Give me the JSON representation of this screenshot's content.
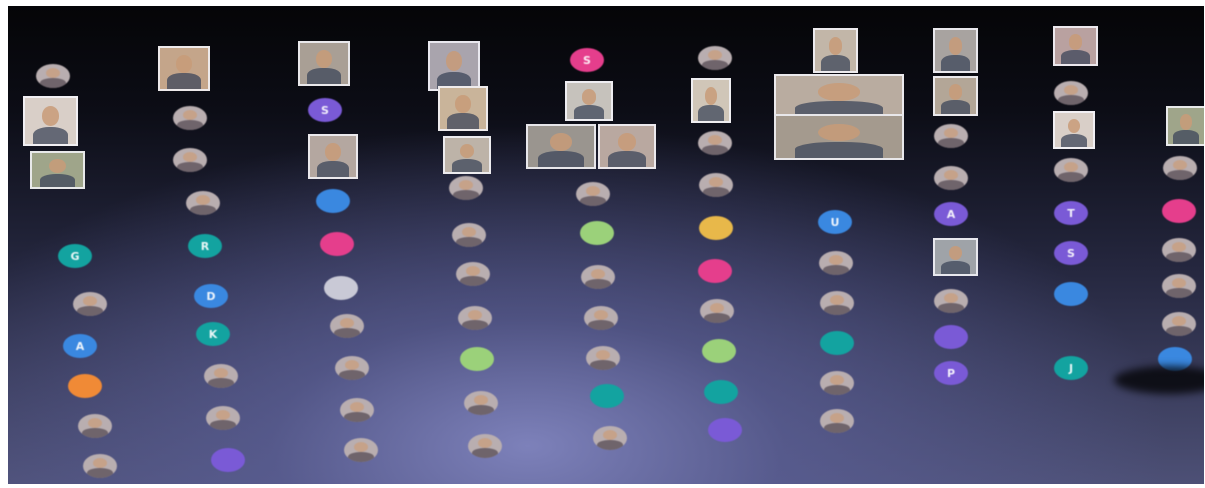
{
  "window": {
    "title": ""
  },
  "colors": {
    "pink": "#e53e8c",
    "purple": "#7a5ad6",
    "blue": "#3a88e0",
    "teal": "#13a3a0",
    "orange": "#f08a36",
    "green": "#9bd17a",
    "yellow": "#e8b84a",
    "gray": "#c9c9d6",
    "photo": "#b9aeb0"
  },
  "tiles": [
    {
      "name": "video-tile-1",
      "bg": "#d9cfc8"
    },
    {
      "name": "video-tile-2",
      "bg": "#9fa58a"
    },
    {
      "name": "video-tile-3",
      "bg": "#c4a58a"
    },
    {
      "name": "video-tile-4",
      "bg": "#a99f95"
    },
    {
      "name": "video-tile-5",
      "bg": "#b4a7a0"
    },
    {
      "name": "video-tile-6",
      "bg": "#a9a4ad"
    },
    {
      "name": "video-tile-7",
      "bg": "#c9b49a"
    },
    {
      "name": "video-tile-8",
      "bg": "#bdb3a8"
    },
    {
      "name": "video-tile-9",
      "bg": "#c6c2bc"
    },
    {
      "name": "video-tile-10",
      "bg": "#9a958f"
    },
    {
      "name": "video-tile-11",
      "bg": "#b9a8a0"
    },
    {
      "name": "video-tile-12",
      "bg": "#d0c6b8"
    },
    {
      "name": "video-tile-13",
      "bg": "#c2b6a8"
    },
    {
      "name": "video-tile-14",
      "bg": "#b9aca0"
    },
    {
      "name": "video-tile-15",
      "bg": "#a49a8e"
    },
    {
      "name": "video-tile-16",
      "bg": "#a8a3a0"
    },
    {
      "name": "video-tile-17",
      "bg": "#b3a697"
    },
    {
      "name": "video-tile-18",
      "bg": "#9fa3a8"
    },
    {
      "name": "video-tile-19",
      "bg": "#b9a1a0"
    }
  ],
  "avatars": [
    {
      "label": "",
      "color": "photo"
    },
    {
      "label": "G",
      "color": "teal"
    },
    {
      "label": "",
      "color": "photo"
    },
    {
      "label": "A",
      "color": "blue"
    },
    {
      "label": "",
      "color": "orange"
    },
    {
      "label": "",
      "color": "photo"
    },
    {
      "label": "",
      "color": "photo"
    },
    {
      "label": "",
      "color": "photo"
    },
    {
      "label": "",
      "color": "photo"
    },
    {
      "label": "",
      "color": "photo"
    },
    {
      "label": "R",
      "color": "teal"
    },
    {
      "label": "D",
      "color": "blue"
    },
    {
      "label": "K",
      "color": "teal"
    },
    {
      "label": "",
      "color": "photo"
    },
    {
      "label": "",
      "color": "photo"
    },
    {
      "label": "",
      "color": "purple"
    },
    {
      "label": "S",
      "color": "purple"
    },
    {
      "label": "",
      "color": "blue"
    },
    {
      "label": "",
      "color": "pink"
    },
    {
      "label": "",
      "color": "gray"
    },
    {
      "label": "",
      "color": "photo"
    },
    {
      "label": "",
      "color": "photo"
    },
    {
      "label": "",
      "color": "photo"
    },
    {
      "label": "",
      "color": "photo"
    },
    {
      "label": "",
      "color": "photo"
    },
    {
      "label": "",
      "color": "photo"
    },
    {
      "label": "",
      "color": "photo"
    },
    {
      "label": "",
      "color": "photo"
    },
    {
      "label": "",
      "color": "green"
    },
    {
      "label": "",
      "color": "photo"
    },
    {
      "label": "",
      "color": "photo"
    },
    {
      "label": "S",
      "color": "pink"
    },
    {
      "label": "",
      "color": "photo"
    },
    {
      "label": "",
      "color": "green"
    },
    {
      "label": "",
      "color": "photo"
    },
    {
      "label": "",
      "color": "photo"
    },
    {
      "label": "",
      "color": "photo"
    },
    {
      "label": "",
      "color": "teal"
    },
    {
      "label": "",
      "color": "photo"
    },
    {
      "label": "",
      "color": "photo"
    },
    {
      "label": "",
      "color": "photo"
    },
    {
      "label": "",
      "color": "photo"
    },
    {
      "label": "",
      "color": "yellow"
    },
    {
      "label": "",
      "color": "pink"
    },
    {
      "label": "",
      "color": "photo"
    },
    {
      "label": "",
      "color": "green"
    },
    {
      "label": "",
      "color": "teal"
    },
    {
      "label": "",
      "color": "purple"
    },
    {
      "label": "U",
      "color": "blue"
    },
    {
      "label": "",
      "color": "photo"
    },
    {
      "label": "",
      "color": "photo"
    },
    {
      "label": "",
      "color": "teal"
    },
    {
      "label": "",
      "color": "photo"
    },
    {
      "label": "",
      "color": "photo"
    },
    {
      "label": "",
      "color": "photo"
    },
    {
      "label": "",
      "color": "photo"
    },
    {
      "label": "A",
      "color": "purple"
    },
    {
      "label": "",
      "color": "photo"
    },
    {
      "label": "",
      "color": "purple"
    },
    {
      "label": "P",
      "color": "purple"
    },
    {
      "label": "",
      "color": "photo"
    },
    {
      "label": "",
      "color": "photo"
    },
    {
      "label": "T",
      "color": "purple"
    },
    {
      "label": "S",
      "color": "purple"
    },
    {
      "label": "",
      "color": "blue"
    },
    {
      "label": "J",
      "color": "teal"
    },
    {
      "label": "",
      "color": "photo"
    },
    {
      "label": "",
      "color": "pink"
    },
    {
      "label": "",
      "color": "photo"
    },
    {
      "label": "",
      "color": "photo"
    },
    {
      "label": "",
      "color": "photo"
    },
    {
      "label": "",
      "color": "blue"
    },
    {
      "label": "",
      "color": "photo"
    }
  ]
}
